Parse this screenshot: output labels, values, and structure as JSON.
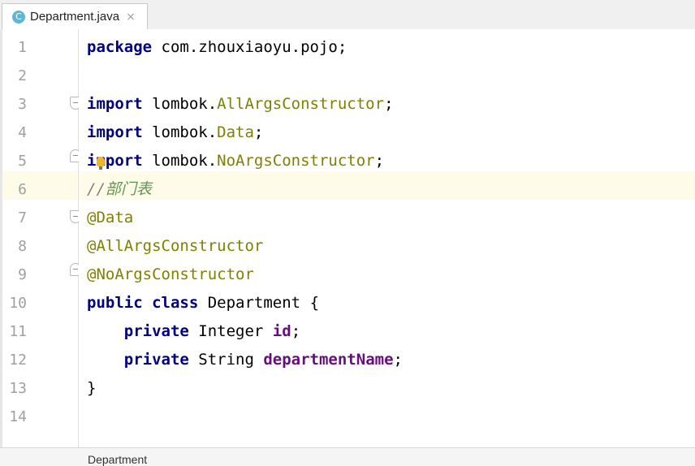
{
  "tab": {
    "icon_letter": "C",
    "title": "Department.java",
    "close_glyph": "×"
  },
  "editor": {
    "line_numbers": [
      "1",
      "2",
      "3",
      "4",
      "5",
      "6",
      "7",
      "8",
      "9",
      "10",
      "11",
      "12",
      "13",
      "14"
    ],
    "lines": {
      "l1": {
        "kw": "package",
        "rest": " com.zhouxiaoyu.pojo;"
      },
      "l3": {
        "kw": "import",
        "pkg": " lombok.",
        "cls": "AllArgsConstructor",
        "end": ";"
      },
      "l4": {
        "kw": "import",
        "pkg": " lombok.",
        "cls": "Data",
        "end": ";"
      },
      "l5": {
        "kw": "import",
        "pkg": " lombok.",
        "cls": "NoArgsConstructor",
        "end": ";"
      },
      "l6": {
        "slashes": "//",
        "text": "部门表"
      },
      "l7": {
        "ann": "@Data"
      },
      "l8": {
        "ann": "@AllArgsConstructor"
      },
      "l9": {
        "ann": "@NoArgsConstructor"
      },
      "l10": {
        "kw1": "public",
        "kw2": "class",
        "rest": " Department {"
      },
      "l11": {
        "indent": "    ",
        "kw": "private",
        "type": " Integer ",
        "field": "id",
        "end": ";"
      },
      "l12": {
        "indent": "    ",
        "kw": "private",
        "type": " String ",
        "field": "departmentName",
        "end": ";"
      },
      "l13": {
        "text": "}"
      }
    },
    "current_line": "6"
  },
  "status": {
    "breadcrumb": "Department"
  },
  "colors": {
    "keyword": "#000080",
    "class_ref": "#808000",
    "annotation": "#808000",
    "field": "#660e7a",
    "comment": "#629755",
    "current_line_bg": "#fefce8"
  },
  "icons": [
    "java-class-icon",
    "close-icon",
    "fold-icon",
    "bulb-icon"
  ]
}
